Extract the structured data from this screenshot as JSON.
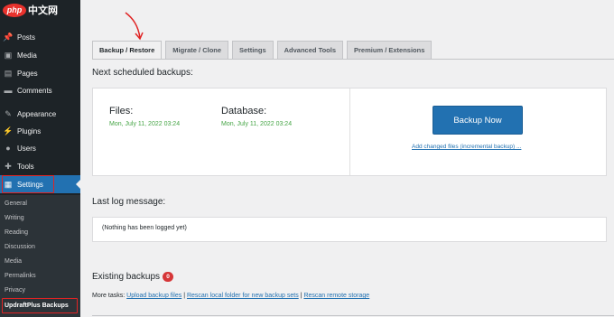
{
  "logo": {
    "badge": "php",
    "text": "中文网"
  },
  "sidebar": {
    "items": [
      {
        "icon": "pin-icon",
        "glyph": "📌",
        "label": "Posts"
      },
      {
        "icon": "media-icon",
        "glyph": "▣",
        "label": "Media"
      },
      {
        "icon": "pages-icon",
        "glyph": "▤",
        "label": "Pages"
      },
      {
        "icon": "comments-icon",
        "glyph": "▬",
        "label": "Comments"
      },
      {
        "icon": "appearance-icon",
        "glyph": "✎",
        "label": "Appearance"
      },
      {
        "icon": "plugins-icon",
        "glyph": "⚡",
        "label": "Plugins"
      },
      {
        "icon": "users-icon",
        "glyph": "👤",
        "label": "Users"
      },
      {
        "icon": "tools-icon",
        "glyph": "🔧",
        "label": "Tools"
      },
      {
        "icon": "settings-icon",
        "glyph": "▦",
        "label": "Settings"
      }
    ],
    "submenu": [
      "General",
      "Writing",
      "Reading",
      "Discussion",
      "Media",
      "Permalinks",
      "Privacy",
      "UpdraftPlus Backups"
    ]
  },
  "tabs": [
    "Backup / Restore",
    "Migrate / Clone",
    "Settings",
    "Advanced Tools",
    "Premium / Extensions"
  ],
  "scheduled": {
    "title": "Next scheduled backups:",
    "files_label": "Files:",
    "files_date": "Mon, July 11, 2022 03:24",
    "db_label": "Database:",
    "db_date": "Mon, July 11, 2022 03:24",
    "backup_button": "Backup Now",
    "incremental_link": "Add changed files (incremental backup) ..."
  },
  "log": {
    "title": "Last log message:",
    "message": "(Nothing has been logged yet)"
  },
  "existing": {
    "title": "Existing backups",
    "count": "0",
    "more_tasks_label": "More tasks:",
    "upload_link": "Upload backup files",
    "rescan_local_link": "Rescan local folder for new backup sets",
    "rescan_remote_link": "Rescan remote storage",
    "separator": "|"
  },
  "colors": {
    "accent": "#2271b1",
    "sidebar": "#1d2327",
    "highlight": "#e02424",
    "date_green": "#46a546"
  }
}
